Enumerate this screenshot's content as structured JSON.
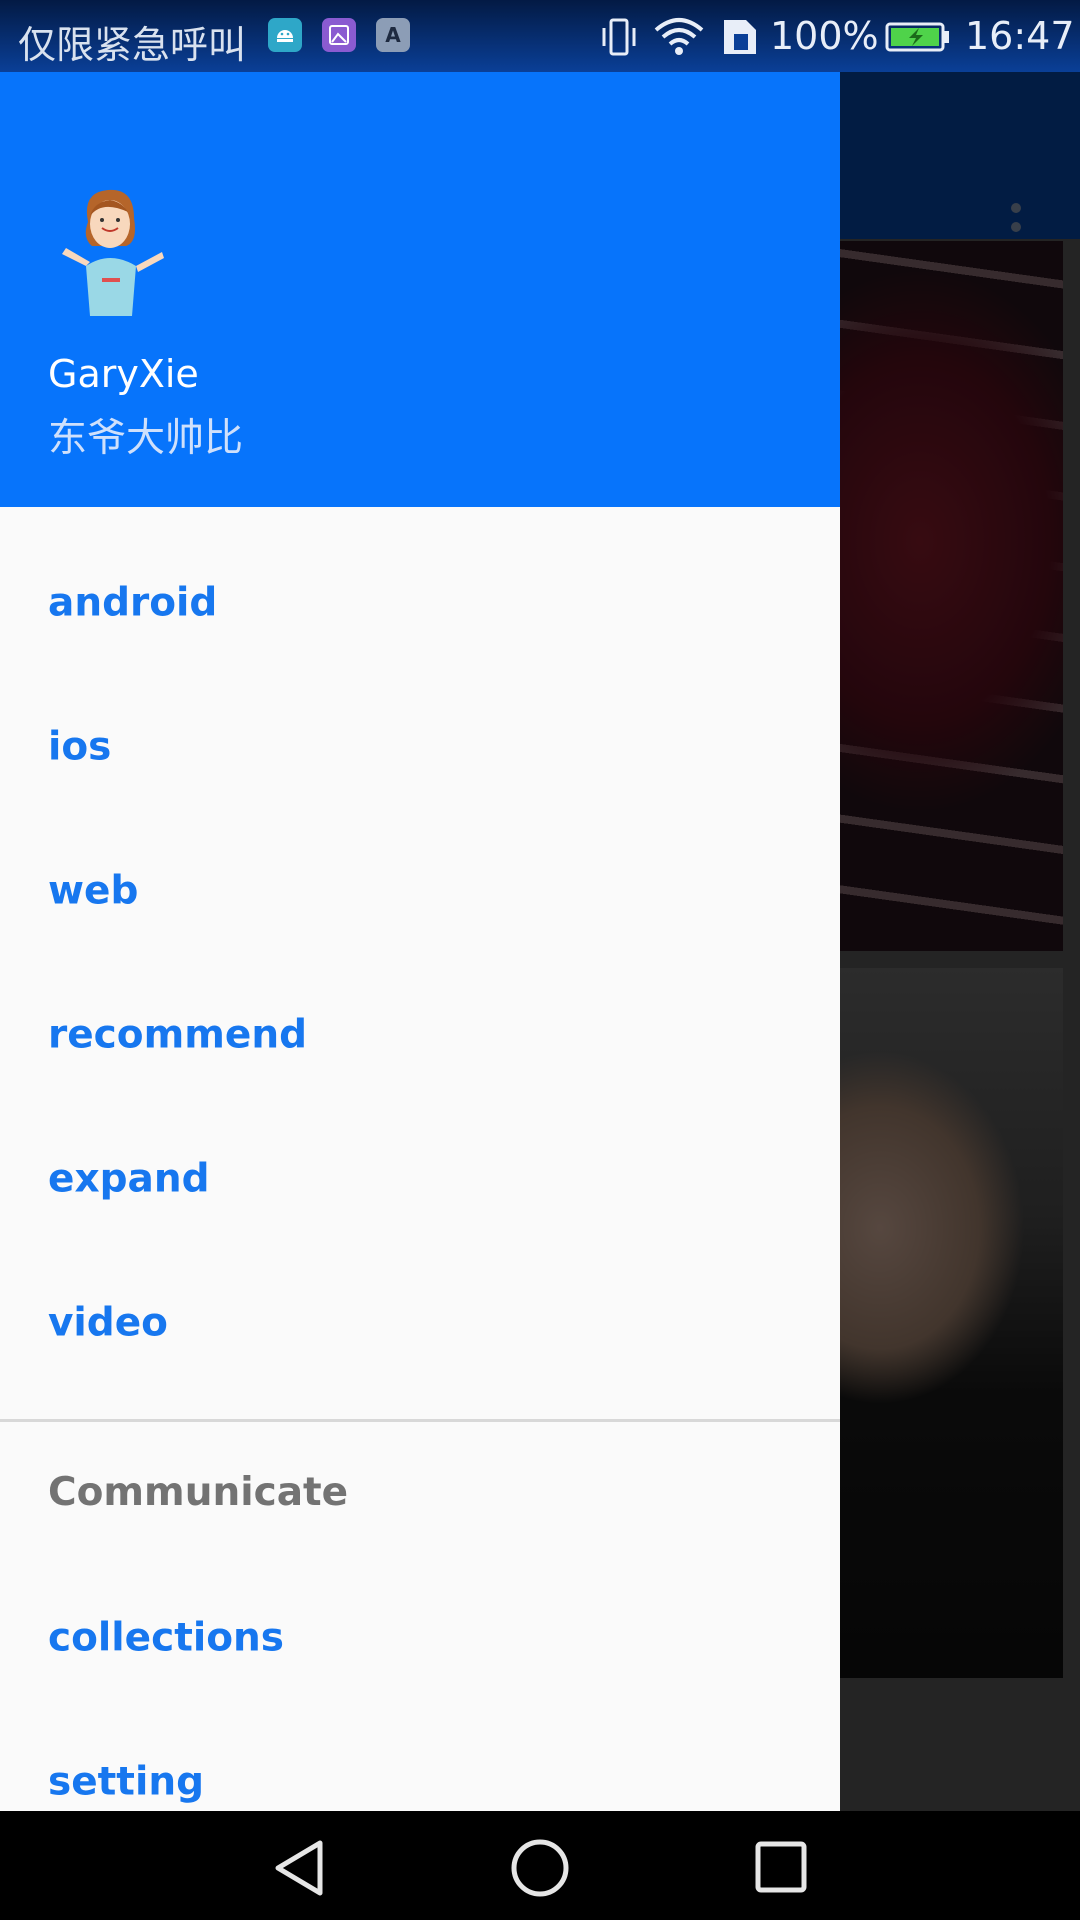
{
  "status_bar": {
    "carrier": "仅限紧急呼叫",
    "notifications": [
      "android-icon",
      "gallery-icon",
      "a-letter-icon"
    ],
    "notification_a_letter": "A",
    "battery_percent": "100%",
    "time": "16:47"
  },
  "drawer": {
    "header": {
      "name": "GaryXie",
      "subtitle": "东爷大帅比"
    },
    "items": [
      {
        "label": "android"
      },
      {
        "label": "ios"
      },
      {
        "label": "web"
      },
      {
        "label": "recommend"
      },
      {
        "label": "expand"
      },
      {
        "label": "video"
      }
    ],
    "section_title": "Communicate",
    "section_items": [
      {
        "label": "collections"
      },
      {
        "label": "setting"
      }
    ]
  },
  "colors": {
    "drawer_header": "#0774fb",
    "menu_text": "#1777ef",
    "toolbar": "#0647a8",
    "section_text": "#737373"
  }
}
